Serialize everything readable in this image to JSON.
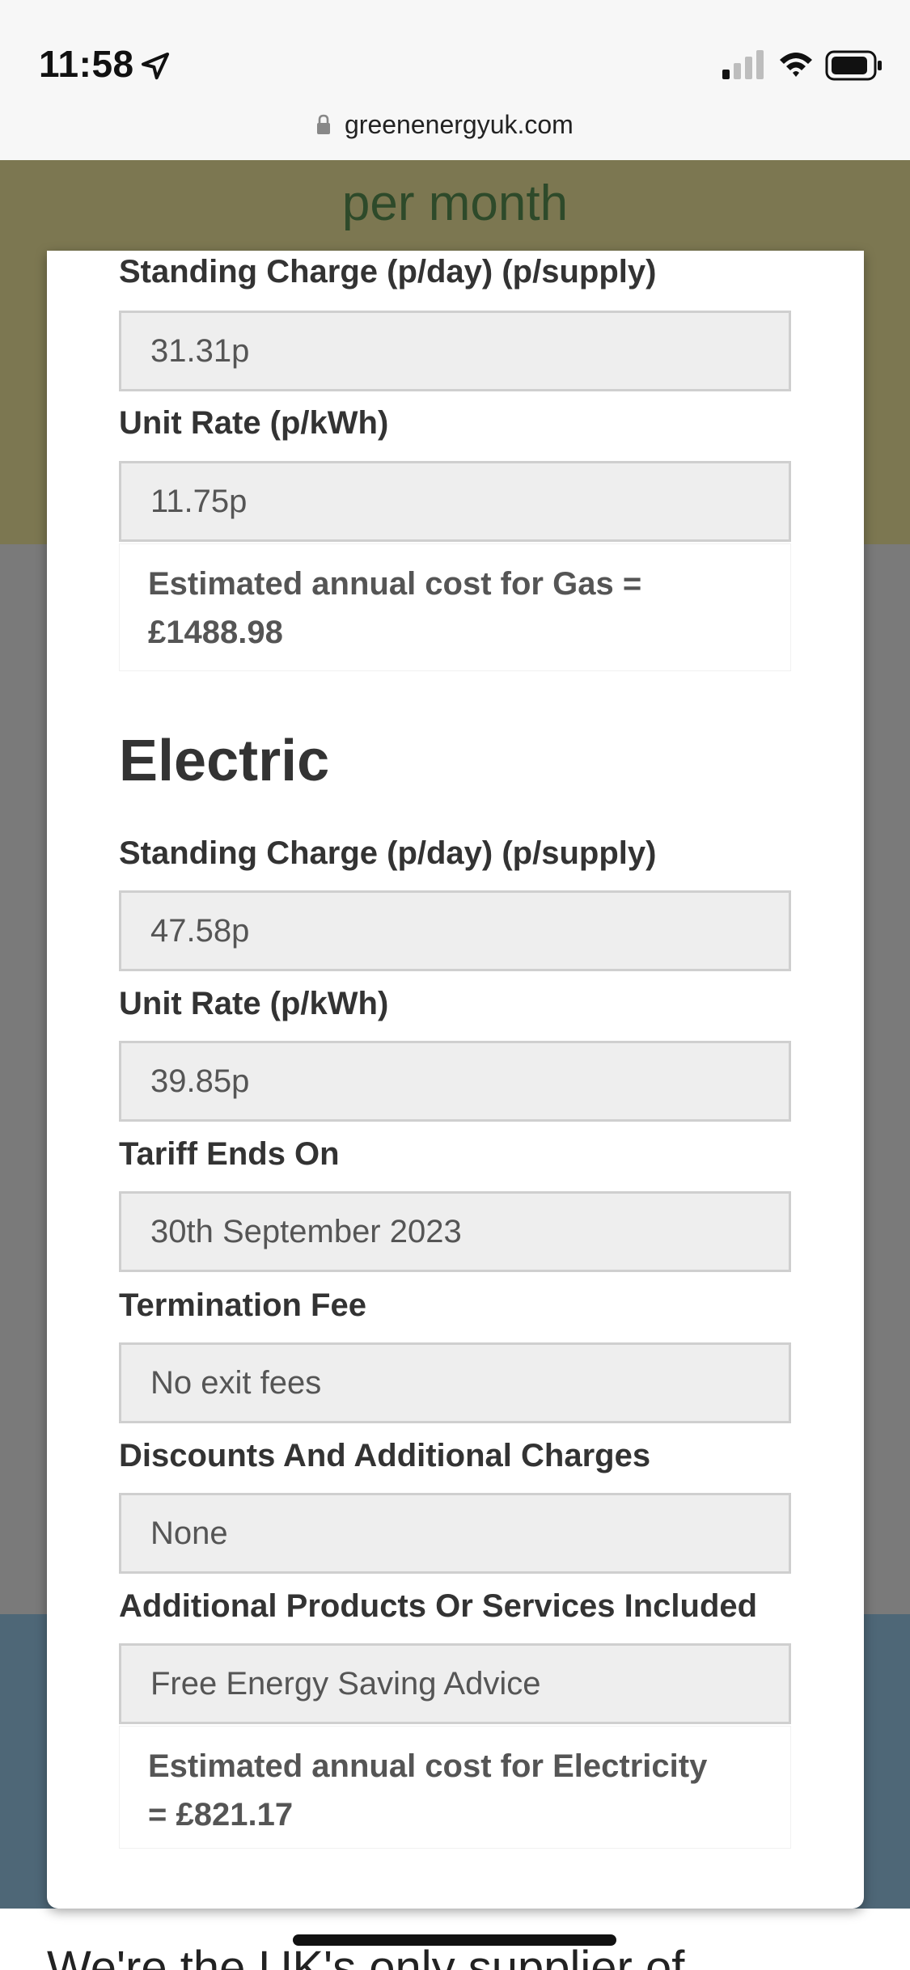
{
  "status_bar": {
    "time": "11:58"
  },
  "browser": {
    "url": "greenenergyuk.com"
  },
  "background": {
    "header_text": "per month",
    "bottom_text": "We're the UK's only supplier of"
  },
  "gas": {
    "standing_charge_label": "Standing Charge (p/day) (p/supply)",
    "standing_charge_value": "31.31p",
    "unit_rate_label": "Unit Rate (p/kWh)",
    "unit_rate_value": "11.75p",
    "estimate_line1": "Estimated annual cost for Gas =",
    "estimate_line2": "£1488.98"
  },
  "electric": {
    "heading": "Electric",
    "standing_charge_label": "Standing Charge (p/day) (p/supply)",
    "standing_charge_value": "47.58p",
    "unit_rate_label": "Unit Rate (p/kWh)",
    "unit_rate_value": "39.85p",
    "tariff_ends_label": "Tariff Ends On",
    "tariff_ends_value": "30th September 2023",
    "termination_fee_label": "Termination Fee",
    "termination_fee_value": "No exit fees",
    "discounts_label": "Discounts And Additional Charges",
    "discounts_value": "None",
    "additional_products_label": "Additional Products Or Services Included",
    "additional_products_value": "Free Energy Saving Advice",
    "estimate_line1": "Estimated annual cost for Electricity",
    "estimate_line2": "= £821.17"
  },
  "icons": {
    "location": "location-arrow-icon",
    "signal": "cellular-signal-icon",
    "wifi": "wifi-icon",
    "battery": "battery-icon",
    "lock": "lock-icon"
  }
}
